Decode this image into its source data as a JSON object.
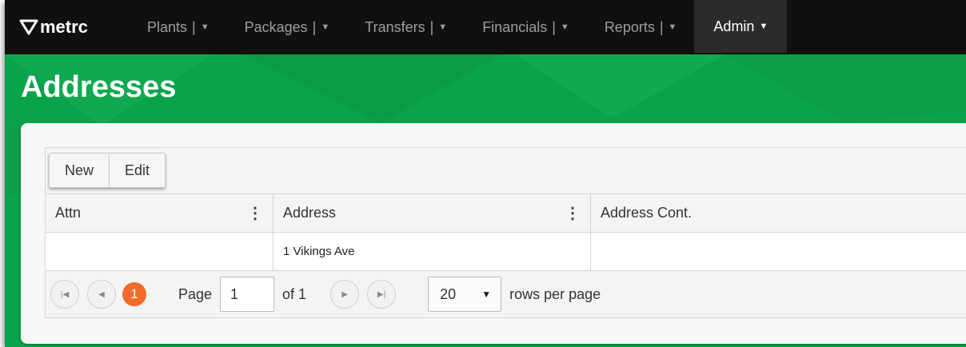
{
  "nav": {
    "brand": "metrc",
    "items": [
      {
        "label": "Plants",
        "sep": "|",
        "active": false
      },
      {
        "label": "Packages",
        "sep": "|",
        "active": false
      },
      {
        "label": "Transfers",
        "sep": "|",
        "active": false
      },
      {
        "label": "Financials",
        "sep": "|",
        "active": false
      },
      {
        "label": "Reports",
        "sep": "|",
        "active": false
      },
      {
        "label": "Admin",
        "sep": "",
        "active": true
      }
    ]
  },
  "page": {
    "title": "Addresses"
  },
  "toolbar": {
    "new_label": "New",
    "edit_label": "Edit"
  },
  "table": {
    "columns": [
      "Attn",
      "Address",
      "Address Cont."
    ],
    "rows": [
      [
        "",
        "1 Vikings Ave",
        ""
      ]
    ]
  },
  "pager": {
    "current_page_badge": "1",
    "page_label": "Page",
    "page_value": "1",
    "of_text": "of 1",
    "rows_per_page_value": "20",
    "rows_per_page_label": "rows per page"
  },
  "colors": {
    "navbar": "#101010",
    "green": "#0aa24a",
    "badge": "#f26b2a"
  }
}
